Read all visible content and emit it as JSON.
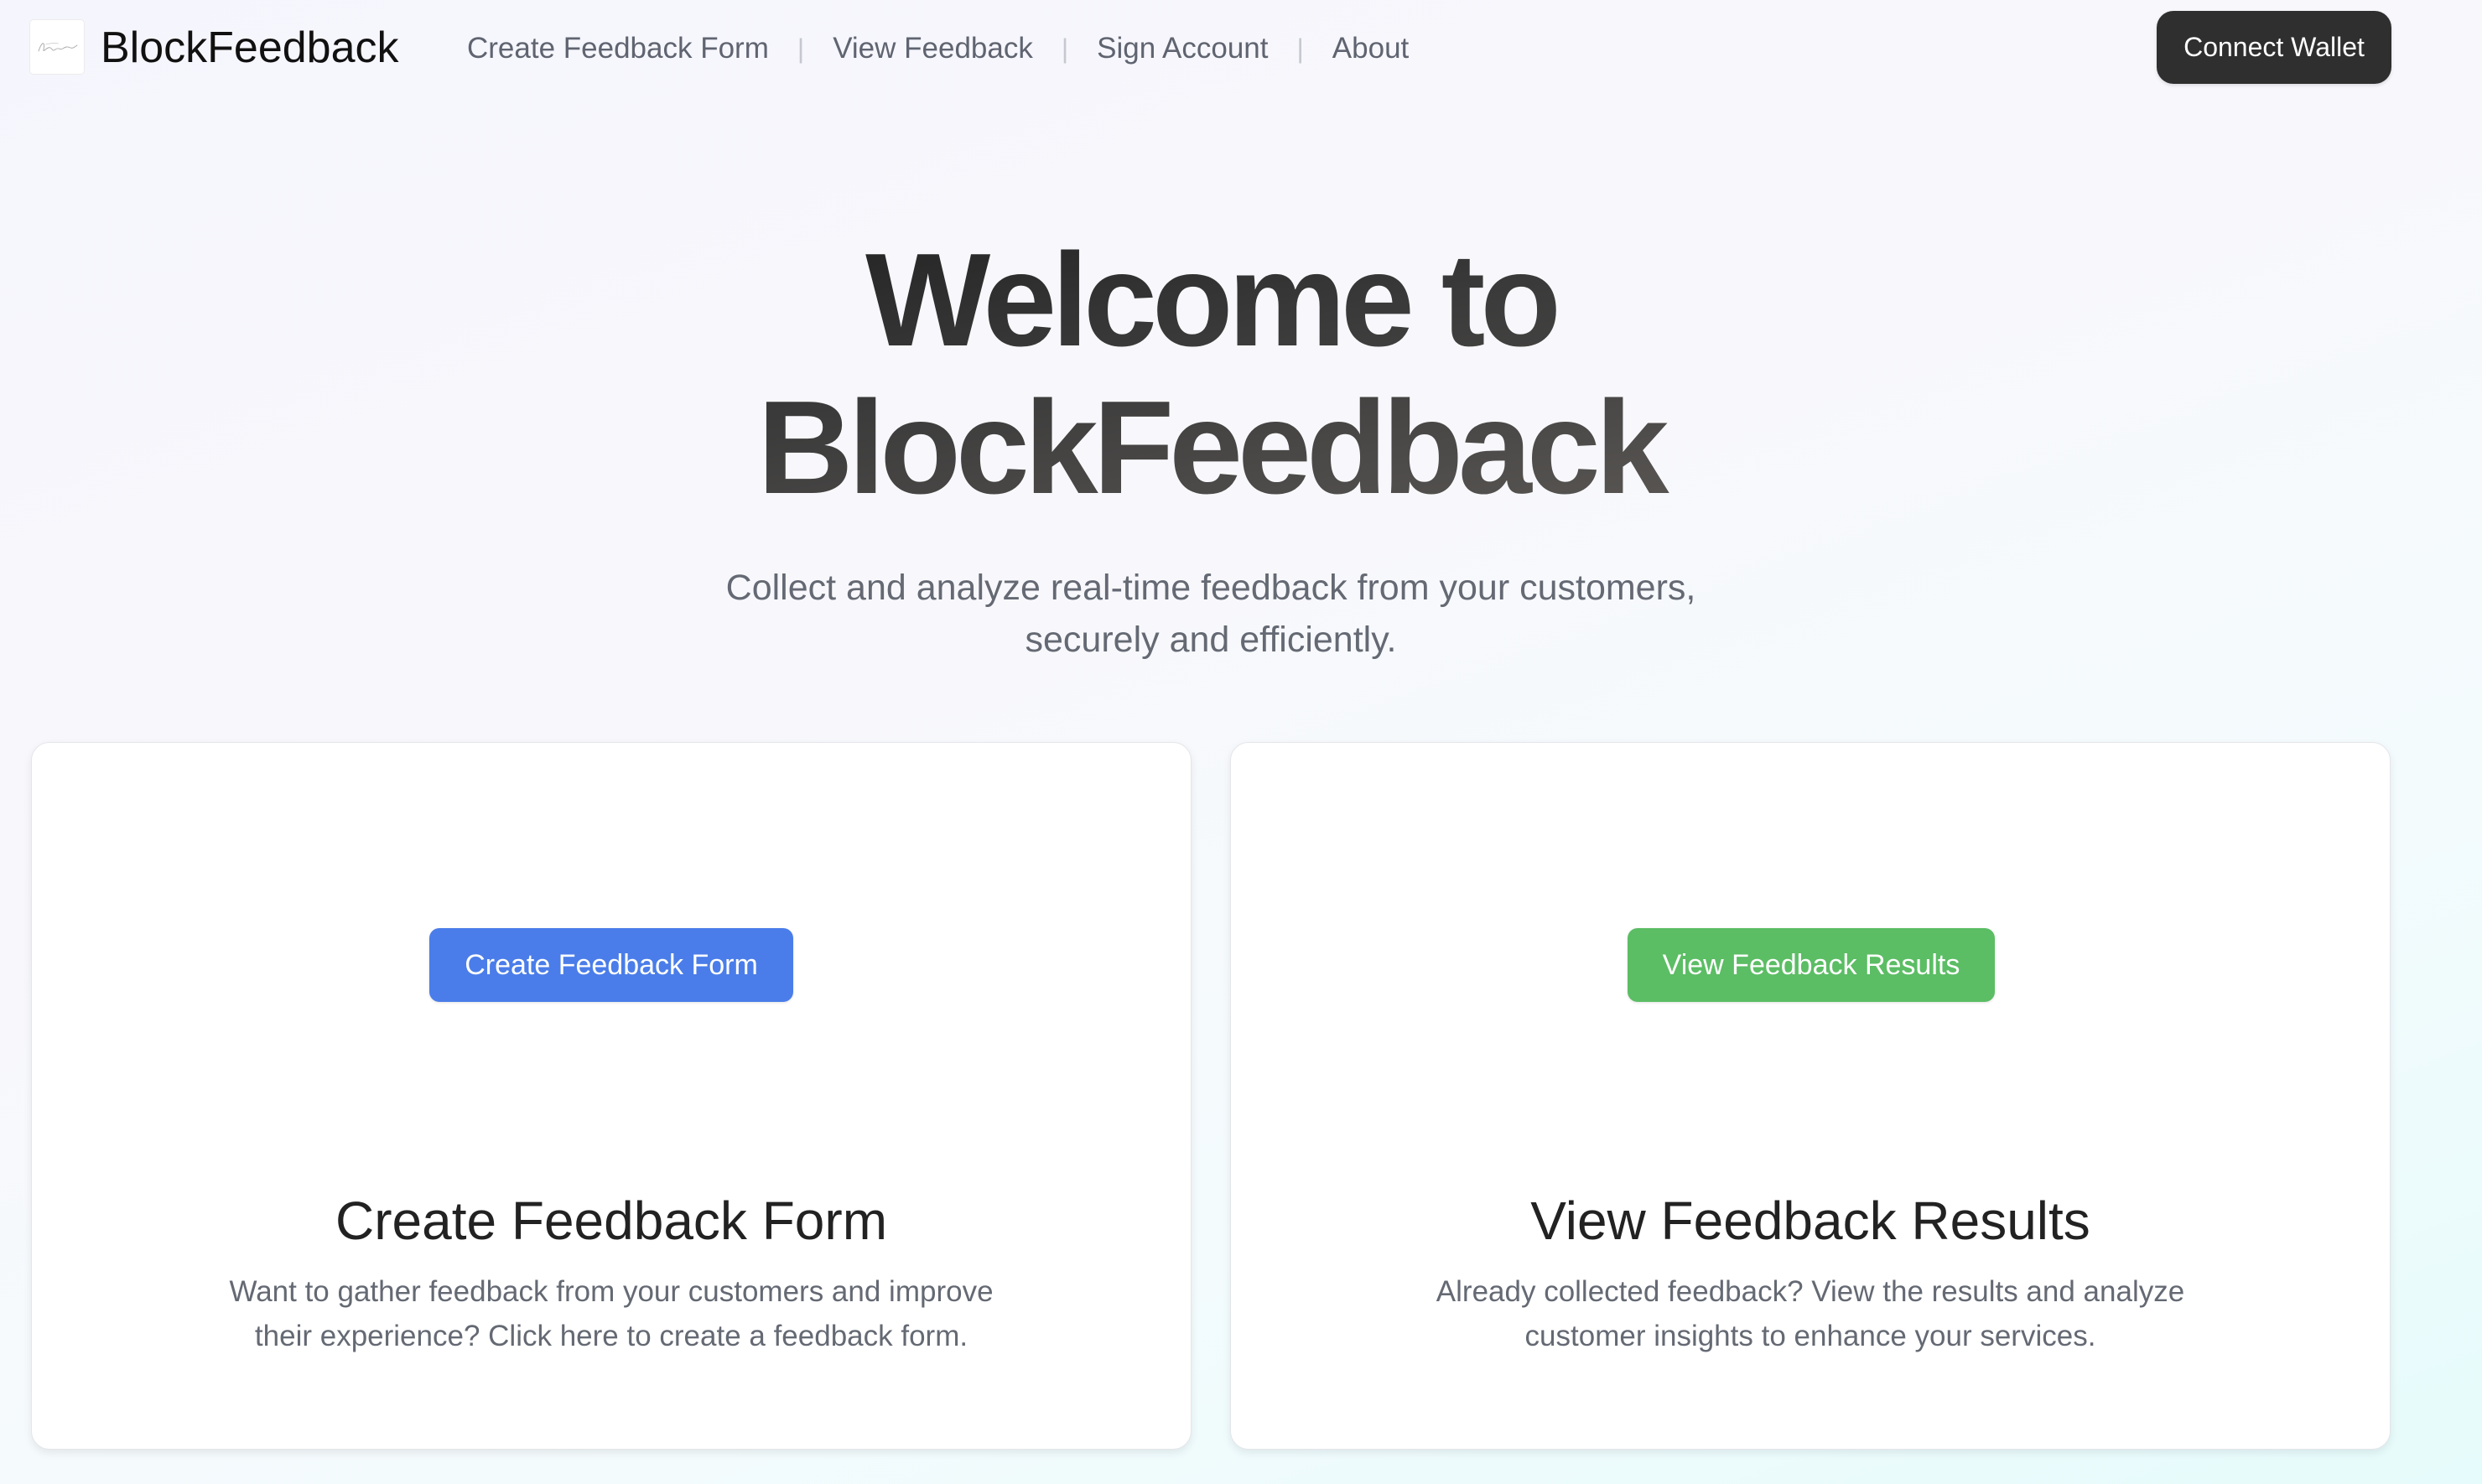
{
  "brand": {
    "name": "BlockFeedback",
    "logo_icon": "signature-logo-icon"
  },
  "nav": {
    "links": [
      {
        "label": "Create Feedback Form"
      },
      {
        "label": "View Feedback"
      },
      {
        "label": "Sign Account"
      },
      {
        "label": "About"
      }
    ],
    "separator": "|",
    "connect_wallet_label": "Connect Wallet"
  },
  "hero": {
    "title_line1": "Welcome to",
    "title_line2": "BlockFeedback",
    "subtitle": "Collect and analyze real-time feedback from your customers, securely and efficiently."
  },
  "cards": [
    {
      "button_label": "Create Feedback Form",
      "button_color": "#4a7de9",
      "title": "Create Feedback Form",
      "description": "Want to gather feedback from your customers and improve their experience? Click here to create a feedback form."
    },
    {
      "button_label": "View Feedback Results",
      "button_color": "#5bbd64",
      "title": "View Feedback Results",
      "description": "Already collected feedback? View the results and analyze customer insights to enhance your services."
    }
  ],
  "colors": {
    "connect_button_bg": "#2f2f2f",
    "nav_text": "#5f6470",
    "muted_text": "#646973"
  }
}
